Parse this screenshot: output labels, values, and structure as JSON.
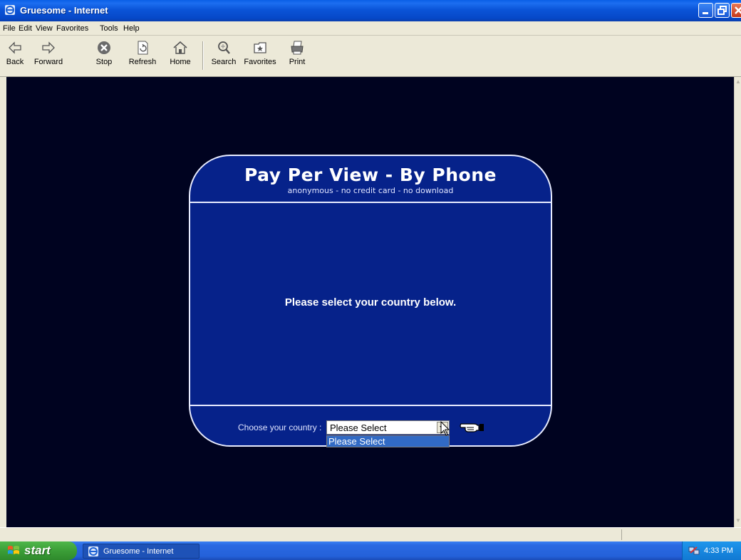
{
  "window": {
    "title": "Gruesome - Internet"
  },
  "menu": [
    "File",
    "Edit",
    "View",
    "Favorites",
    "Tools",
    "Help"
  ],
  "toolbar": {
    "back": "Back",
    "forward": "Forward",
    "stop": "Stop",
    "refresh": "Refresh",
    "home": "Home",
    "search": "Search",
    "favorites": "Favorites",
    "print": "Print"
  },
  "panel": {
    "heading": "Pay Per View - By Phone",
    "subheading": "anonymous - no credit card - no download",
    "message": "Please select your country below.",
    "country_label": "Choose your country :",
    "select_value": "Please Select",
    "options": [
      "Please Select"
    ]
  },
  "taskbar": {
    "start": "start",
    "task": "Gruesome - Internet",
    "time": "4:33 PM"
  },
  "colors": {
    "page_bg": "#000320",
    "panel_bg": "#06228a",
    "accent": "#316ac5"
  }
}
